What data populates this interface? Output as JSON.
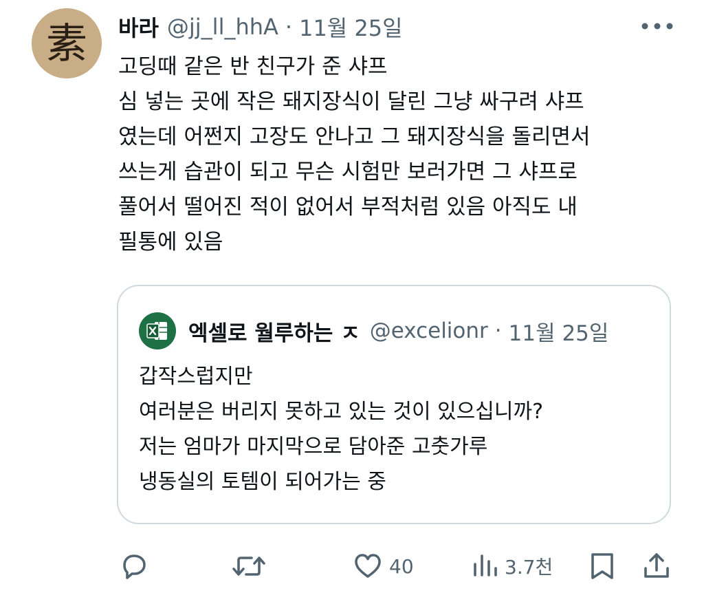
{
  "tweet": {
    "avatar_glyph": "素",
    "author_name": "바라",
    "handle": "@jj_ll_hhA",
    "separator": "·",
    "date": "11월 25일",
    "more_icon": "more-horizontal-icon",
    "text_lines": [
      "고딩때 같은 반 친구가 준 샤프",
      "심 넣는 곳에 작은 돼지장식이 달린 그냥 싸구려 샤프",
      "였는데 어쩐지 고장도 안나고 그 돼지장식을 돌리면서",
      "쓰는게 습관이 되고 무슨 시험만 보러가면 그 샤프로",
      "풀어서 떨어진 적이 없어서 부적처럼 있음 아직도 내",
      "필통에 있음"
    ]
  },
  "quote": {
    "avatar_icon": "excel-logo-icon",
    "author_name": "엑셀로 월루하는 ㅈ",
    "handle": "@excelionr",
    "separator": "·",
    "date": "11월 25일",
    "text_lines": [
      "갑작스럽지만",
      "여러분은 버리지 못하고 있는 것이 있으십니까?",
      "저는 엄마가 마지막으로 담아준 고춧가루",
      "냉동실의 토템이 되어가는 중"
    ]
  },
  "actions": {
    "reply_icon": "reply-icon",
    "retweet_icon": "retweet-icon",
    "like_icon": "heart-icon",
    "like_count": "40",
    "views_icon": "views-chart-icon",
    "views_count": "3.7천",
    "bookmark_icon": "bookmark-icon",
    "share_icon": "share-icon"
  },
  "colors": {
    "text": "#0f1419",
    "secondary": "#536471",
    "border": "#cfd9de",
    "excel_green": "#1e7145",
    "avatar_bg": "#c8ad86"
  }
}
